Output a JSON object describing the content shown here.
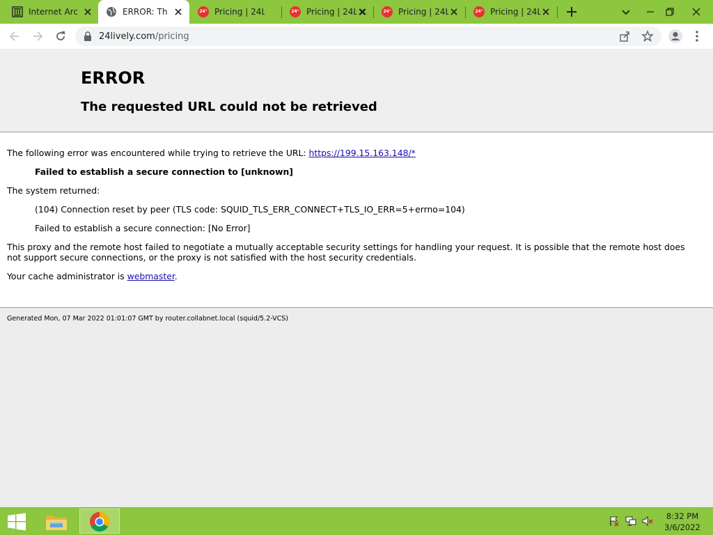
{
  "browser": {
    "tabs": [
      {
        "title": "Internet Arch",
        "favicon": "archive-icon",
        "active": false
      },
      {
        "title": "ERROR: The r",
        "favicon": "globe-icon",
        "active": true
      },
      {
        "title": "Pricing | 24L",
        "favicon": "24lively-icon",
        "active": false
      },
      {
        "title": "Pricing | 24L",
        "favicon": "24lively-icon",
        "active": false
      },
      {
        "title": "Pricing | 24L",
        "favicon": "24lively-icon",
        "active": false
      },
      {
        "title": "Pricing | 24L",
        "favicon": "24lively-icon",
        "active": false
      }
    ],
    "favicon_text": "24°",
    "url": {
      "host": "24lively.com",
      "path": "/pricing"
    }
  },
  "page": {
    "header": {
      "title": "ERROR",
      "subtitle": "The requested URL could not be retrieved"
    },
    "body": {
      "encountered_text": "The following error was encountered while trying to retrieve the URL: ",
      "encountered_link": "https://199.15.163.148/*",
      "failed_secure": "Failed to establish a secure connection to [unknown]",
      "system_returned": "The system returned:",
      "code_line": "(104) Connection reset by peer (TLS code: SQUID_TLS_ERR_CONNECT+TLS_IO_ERR=5+errno=104)",
      "no_error_line": "Failed to establish a secure connection: [No Error]",
      "explanation": "This proxy and the remote host failed to negotiate a mutually acceptable security settings for handling your request. It is possible that the remote host does not support secure connections, or the proxy is not satisfied with the host security credentials.",
      "admin_text": "Your cache administrator is ",
      "admin_link": "webmaster",
      "admin_end": "."
    },
    "footer": {
      "generated": "Generated Mon, 07 Mar 2022 01:01:07 GMT by router.collabnet.local (squid/5.2-VCS)"
    }
  },
  "taskbar": {
    "clock_time": "8:32 PM",
    "clock_date": "3/6/2022"
  },
  "colors": {
    "accent": "#8dc63f",
    "link": "#1a0dab",
    "favicon_red": "#e8322f"
  }
}
